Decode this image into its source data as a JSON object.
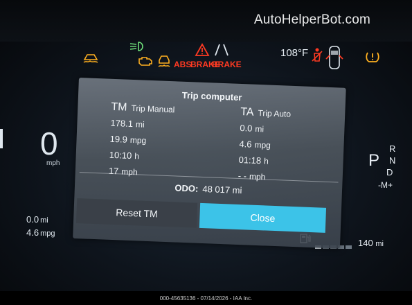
{
  "watermark": "AutoHelperBot.com",
  "caption": "000-45635136 - 07/14/2026 - IAA Inc.",
  "header": {
    "outside_temp": "108°F",
    "abs_label": "ABS",
    "brake_label_1": "BRAKE",
    "brake_label_2": "BRAKE"
  },
  "left": {
    "speed": "0",
    "speed_unit": "mph",
    "distance": "0.0",
    "distance_unit": "mi",
    "economy": "4.6",
    "economy_unit": "mpg"
  },
  "right": {
    "gear_selected": "P",
    "gears": [
      "R",
      "N",
      "D"
    ],
    "mode": "-M+",
    "range_value": "140",
    "range_unit": "mi",
    "fuel_segments": 5,
    "fuel_filled": 1
  },
  "dialog": {
    "title": "Trip computer",
    "trip_manual": {
      "abbr": "TM",
      "name": "Trip Manual",
      "distance": "178.1",
      "distance_unit": "mi",
      "economy": "19.9",
      "economy_unit": "mpg",
      "time": "10:10",
      "time_unit": "h",
      "avg_speed": "17",
      "avg_speed_unit": "mph"
    },
    "trip_auto": {
      "abbr": "TA",
      "name": "Trip Auto",
      "distance": "0.0",
      "distance_unit": "mi",
      "economy": "4.6",
      "economy_unit": "mpg",
      "time": "01:18",
      "time_unit": "h",
      "avg_speed": "- -",
      "avg_speed_unit": "mph"
    },
    "odo_label": "ODO:",
    "odo_value": "48 017 mi",
    "reset_label": "Reset TM",
    "close_label": "Close"
  },
  "colors": {
    "close_button": "#3cc3e8",
    "warning_red": "#ff3a22",
    "warning_amber": "#ffb020",
    "indicator_green": "#6fe07a"
  },
  "icons": [
    "low-beam-icon",
    "traction-off-icon",
    "check-engine-icon",
    "stability-icon",
    "hazard-triangle-icon",
    "lane-assist-icon",
    "seatbelt-icon",
    "door-ajar-icon",
    "tire-pressure-icon",
    "fuel-pump-icon"
  ]
}
